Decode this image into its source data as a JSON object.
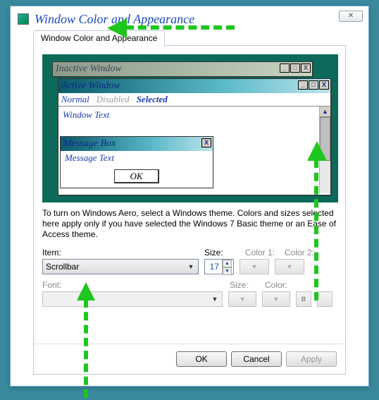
{
  "header": {
    "title": "Window Color and Appearance",
    "close_glyph": "✕"
  },
  "tab": {
    "label": "Window Color and Appearance"
  },
  "preview": {
    "inactive_title": "Inactive Window",
    "active_title": "Active Window",
    "menu": {
      "normal": "Normal",
      "disabled": "Disabled",
      "selected": "Selected"
    },
    "window_text": "Window Text",
    "msgbox_title": "Message Box",
    "msg_text": "Message Text",
    "msg_ok": "OK",
    "winbtn": {
      "min": "_",
      "max": "□",
      "close": "X"
    },
    "scroll_up": "▲"
  },
  "help_text": "To turn on Windows Aero, select a Windows theme.  Colors and sizes selected here apply only if you have selected the Windows 7 Basic theme or an Ease of Access theme.",
  "labels": {
    "item": "Item:",
    "size": "Size:",
    "color1": "Color 1:",
    "color2": "Color 2:",
    "font": "Font:",
    "fsize": "Size:",
    "fcolor": "Color:"
  },
  "item_dropdown": {
    "value": "Scrollbar",
    "arrow": "▼"
  },
  "size_value": "17",
  "spin": {
    "up": "▲",
    "down": "▼"
  },
  "color_arrow": "▼",
  "bold_label": "B",
  "buttons": {
    "ok": "OK",
    "cancel": "Cancel",
    "apply": "Apply"
  },
  "colors": {
    "preview_bg": "#0d6a5a"
  }
}
